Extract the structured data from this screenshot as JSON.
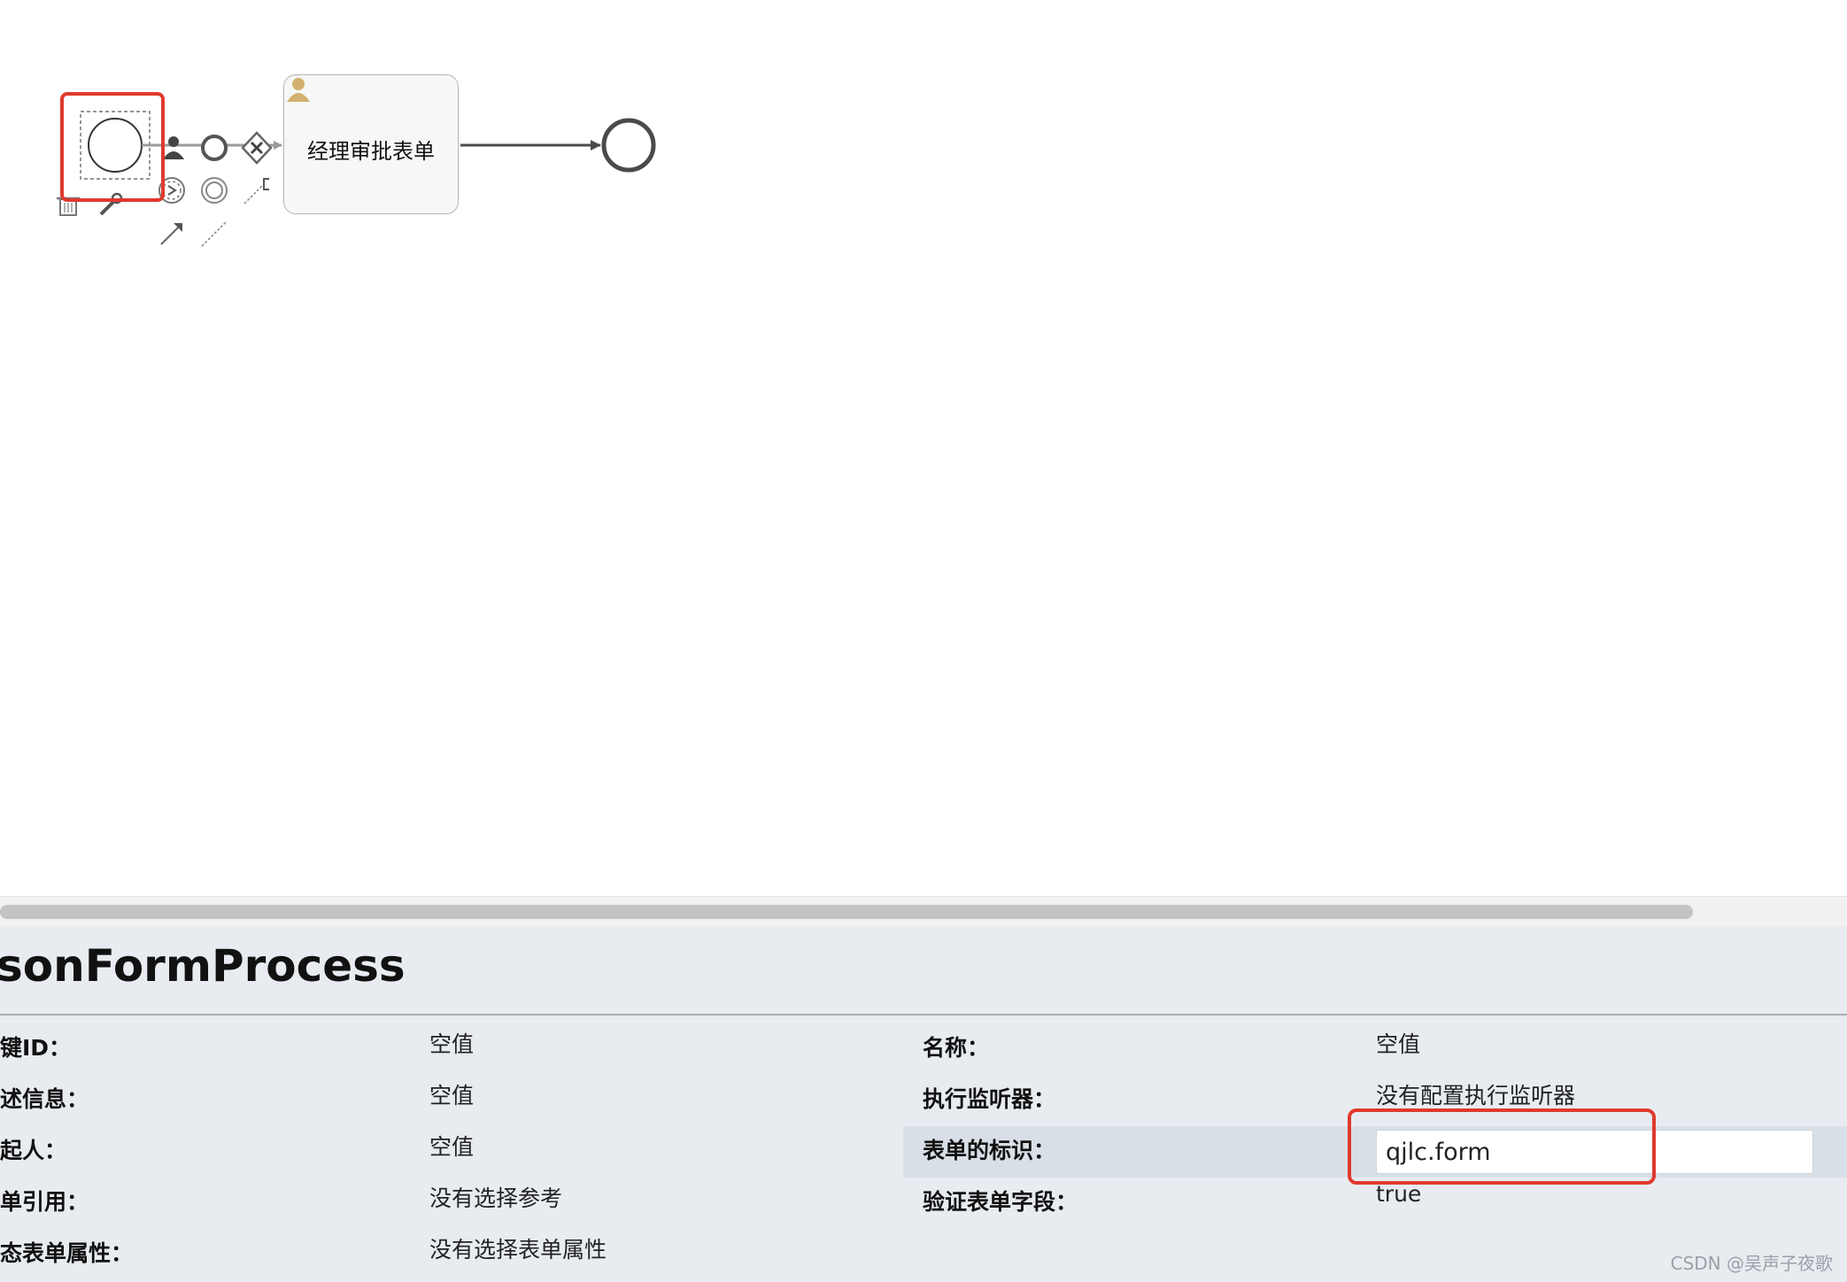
{
  "diagram": {
    "task_label": "经理审批表单"
  },
  "properties": {
    "title": "sonFormProcess",
    "left_rows": [
      {
        "label": "键ID：",
        "value": "空值"
      },
      {
        "label": "述信息：",
        "value": "空值"
      },
      {
        "label": "起人：",
        "value": "空值"
      },
      {
        "label": "单引用：",
        "value": "没有选择参考"
      },
      {
        "label": "态表单属性：",
        "value": "没有选择表单属性"
      }
    ],
    "right_rows": [
      {
        "label": "名称：",
        "value": "空值"
      },
      {
        "label": "执行监听器：",
        "value": "没有配置执行监听器"
      },
      {
        "label": "表单的标识：",
        "value": "qjlc.form"
      },
      {
        "label": "验证表单字段：",
        "value": "true"
      }
    ]
  },
  "highlight_color": "#e03a2f",
  "watermark": "CSDN @吴声子夜歌"
}
